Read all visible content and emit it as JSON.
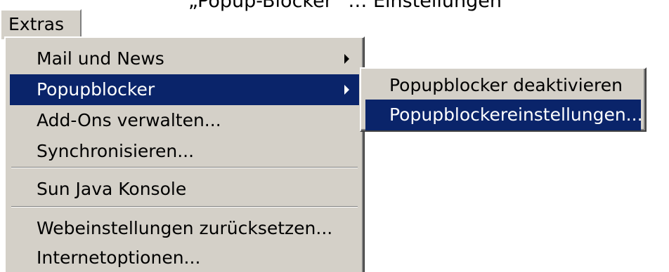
{
  "top_text": "„Popup-Blocker“ … Einstellungen",
  "menubar": {
    "label": "Extras"
  },
  "main_menu": {
    "items": [
      {
        "label": "Mail und News",
        "has_submenu": true
      },
      {
        "label": "Popupblocker",
        "has_submenu": true,
        "highlighted": true
      },
      {
        "label": "Add-Ons verwalten...",
        "has_submenu": false
      },
      {
        "label": "Synchronisieren...",
        "has_submenu": false
      },
      {
        "label": "Sun Java Konsole",
        "has_submenu": false
      },
      {
        "label": "Webeinstellungen zurücksetzen...",
        "has_submenu": false
      },
      {
        "label": "Internetoptionen...",
        "has_submenu": false
      }
    ]
  },
  "sub_menu": {
    "items": [
      {
        "label": "Popupblocker deaktivieren"
      },
      {
        "label": "Popupblockereinstellungen...",
        "highlighted": true
      }
    ]
  },
  "colors": {
    "menu_bg": "#d4d0c8",
    "highlight_bg": "#0a246a",
    "highlight_text": "#ffffff"
  }
}
